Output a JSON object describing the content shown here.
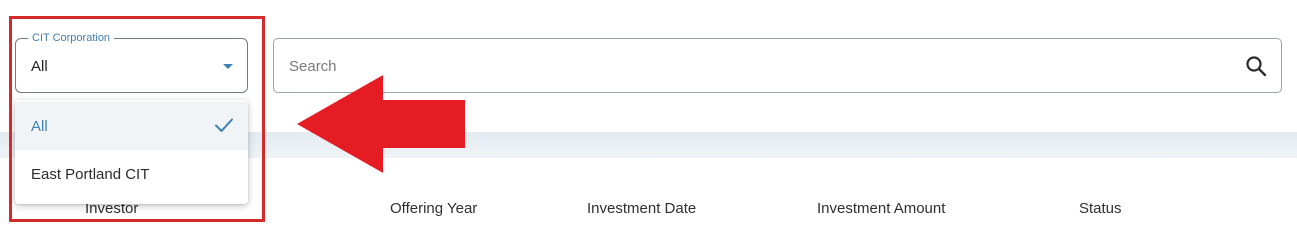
{
  "filter": {
    "label": "CIT Corporation",
    "value": "All",
    "options": [
      {
        "label": "All",
        "selected": true
      },
      {
        "label": "East Portland CIT",
        "selected": false
      }
    ]
  },
  "search": {
    "placeholder": "Search"
  },
  "table": {
    "columns": [
      "Investor",
      "Offering Year",
      "Investment Date",
      "Investment Amount",
      "Status"
    ]
  },
  "colors": {
    "accent": "#3f7fb3",
    "highlight": "#d42a2a",
    "arrow": "#e51c23",
    "header_band": "#e6edf1"
  },
  "icons": {
    "caret": "caret-down-icon",
    "check": "check-icon",
    "search": "search-icon",
    "annotation": "arrow-left-icon"
  }
}
